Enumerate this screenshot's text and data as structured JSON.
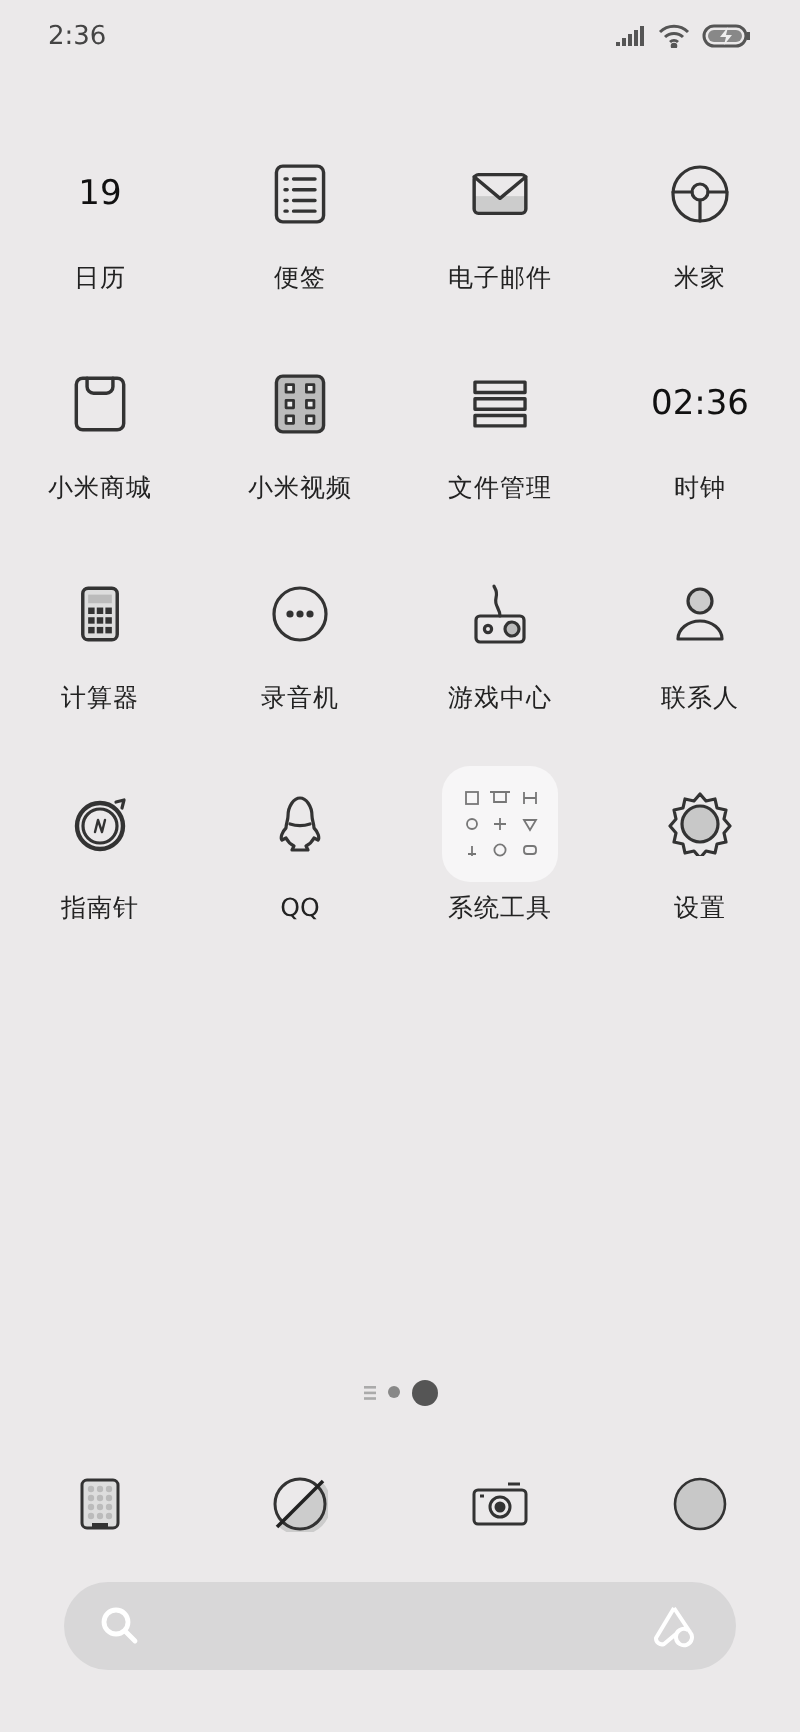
{
  "status_bar": {
    "time": "2:36"
  },
  "apps": [
    {
      "label": "日历",
      "kind": "text",
      "icon_text": "19"
    },
    {
      "label": "便签",
      "kind": "icon"
    },
    {
      "label": "电子邮件",
      "kind": "icon"
    },
    {
      "label": "米家",
      "kind": "icon"
    },
    {
      "label": "小米商城",
      "kind": "icon"
    },
    {
      "label": "小米视频",
      "kind": "icon"
    },
    {
      "label": "文件管理",
      "kind": "icon"
    },
    {
      "label": "时钟",
      "kind": "text",
      "icon_text": "02:36"
    },
    {
      "label": "计算器",
      "kind": "icon"
    },
    {
      "label": "录音机",
      "kind": "icon"
    },
    {
      "label": "游戏中心",
      "kind": "icon"
    },
    {
      "label": "联系人",
      "kind": "icon"
    },
    {
      "label": "指南针",
      "kind": "icon"
    },
    {
      "label": "QQ",
      "kind": "icon"
    },
    {
      "label": "系统工具",
      "kind": "folder"
    },
    {
      "label": "设置",
      "kind": "icon"
    }
  ],
  "page_indicator": [
    {
      "kind": "list",
      "selected": false
    },
    {
      "kind": "dot",
      "selected": false
    },
    {
      "kind": "dot",
      "selected": true
    }
  ]
}
